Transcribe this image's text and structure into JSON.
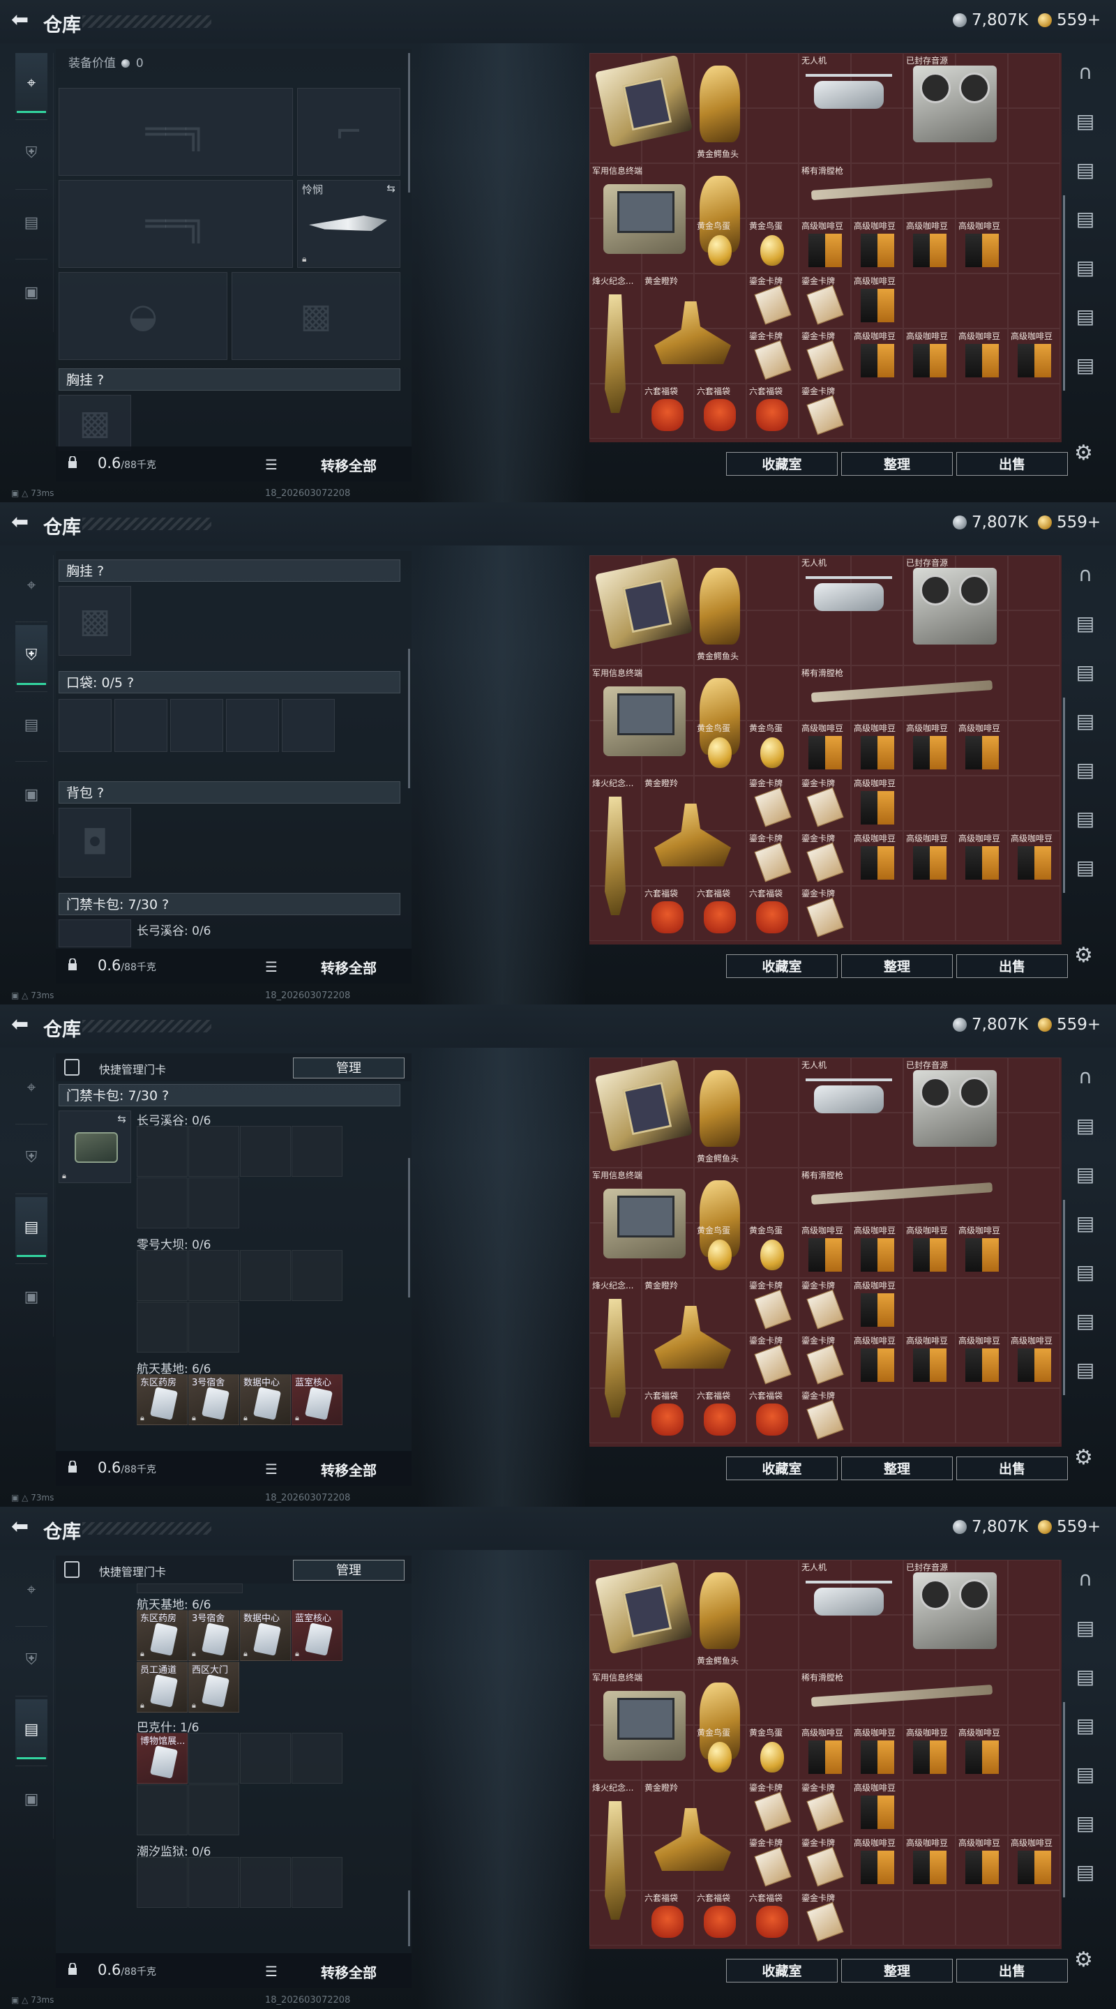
{
  "app": {
    "title": "仓库"
  },
  "currency": {
    "silver": "7,807K",
    "gold": "559+"
  },
  "bottom": {
    "weight": "0.6",
    "weight_cap": "/88千克",
    "transfer_all": "转移全部"
  },
  "status": {
    "ping": "73ms",
    "build": "18_202603072208"
  },
  "vault": {
    "buttons": {
      "collection": "收藏室",
      "sort": "整理",
      "sell": "出售"
    },
    "labels": {
      "drone": "无人机",
      "sealed_source": "已封存音源",
      "golden_croc": "黄金鳄鱼头",
      "military_terminal": "军用信息终端",
      "rare_gun": "稀有滑膛枪",
      "golden_egg_a": "黄金鸟蛋",
      "golden_egg_b": "黄金鸟蛋",
      "coffee": "高级咖啡豆",
      "memorial": "烽火纪念...",
      "golden_antelope": "黄金瞪羚",
      "gold_leaf": "鎏金卡牌",
      "six_set": "六套福袋"
    }
  },
  "frame1": {
    "equipment_value_label": "装备价值",
    "equipment_value": "0",
    "melee_label": "怜悯",
    "chest_header": "胸挂 ?"
  },
  "frame2": {
    "chest_header": "胸挂 ?",
    "pockets_header": "口袋: 0/5 ?",
    "backpack_header": "背包 ?",
    "keycard_header": "门禁卡包: 7/30 ?",
    "changgong_label": "长弓溪谷: 0/6"
  },
  "frame3": {
    "manage_label": "快捷管理门卡",
    "manage_btn": "管理",
    "keycard_header": "门禁卡包: 7/30 ?",
    "changgong_label": "长弓溪谷: 0/6",
    "dam_label": "零号大坝: 0/6",
    "aerospace_label": "航天基地: 6/6",
    "cards": [
      "东区药房",
      "3号宿舍",
      "数据中心",
      "蓝室核心"
    ]
  },
  "frame4": {
    "manage_label": "快捷管理门卡",
    "manage_btn": "管理",
    "aerospace_label": "航天基地: 6/6",
    "cards_row1": [
      "东区药房",
      "3号宿舍",
      "数据中心",
      "蓝室核心"
    ],
    "cards_row2": [
      "员工通道",
      "西区大门"
    ],
    "bakeshi_label": "巴克什: 1/6",
    "bakeshi_card": "博物馆展...",
    "prison_label": "潮汐监狱: 0/6"
  }
}
